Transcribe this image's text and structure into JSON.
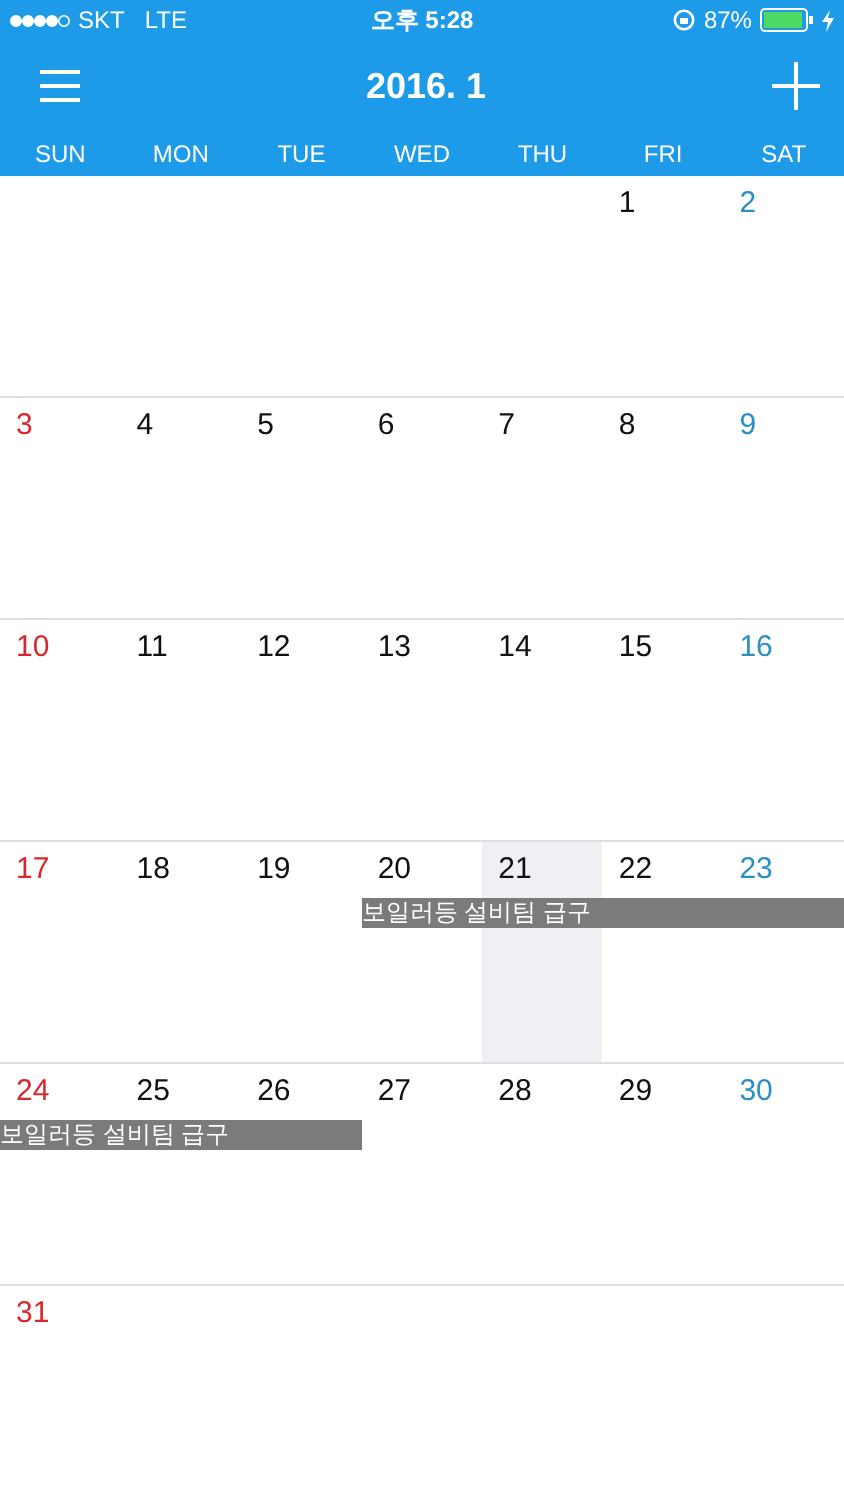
{
  "status_bar": {
    "carrier": "SKT",
    "network": "LTE",
    "time": "오후 5:28",
    "battery": "87%"
  },
  "header": {
    "title": "2016. 1"
  },
  "weekdays": [
    "SUN",
    "MON",
    "TUE",
    "WED",
    "THU",
    "FRI",
    "SAT"
  ],
  "weeks": [
    {
      "days": [
        {
          "kind": "blank"
        },
        {
          "kind": "blank"
        },
        {
          "kind": "blank"
        },
        {
          "kind": "blank"
        },
        {
          "kind": "blank"
        },
        {
          "kind": "date",
          "label": "1",
          "today": false
        },
        {
          "kind": "date",
          "label": "2",
          "today": false
        }
      ]
    },
    {
      "days": [
        {
          "kind": "date",
          "label": "3",
          "today": false
        },
        {
          "kind": "date",
          "label": "4",
          "today": false
        },
        {
          "kind": "date",
          "label": "5",
          "today": false
        },
        {
          "kind": "date",
          "label": "6",
          "today": false
        },
        {
          "kind": "date",
          "label": "7",
          "today": false
        },
        {
          "kind": "date",
          "label": "8",
          "today": false
        },
        {
          "kind": "date",
          "label": "9",
          "today": false
        }
      ]
    },
    {
      "days": [
        {
          "kind": "date",
          "label": "10",
          "today": false
        },
        {
          "kind": "date",
          "label": "11",
          "today": false
        },
        {
          "kind": "date",
          "label": "12",
          "today": false
        },
        {
          "kind": "date",
          "label": "13",
          "today": false
        },
        {
          "kind": "date",
          "label": "14",
          "today": false
        },
        {
          "kind": "date",
          "label": "15",
          "today": false
        },
        {
          "kind": "date",
          "label": "16",
          "today": false
        }
      ]
    },
    {
      "event_title": "보일러등 설비팀 급구",
      "days": [
        {
          "kind": "date",
          "label": "17",
          "today": false
        },
        {
          "kind": "date",
          "label": "18",
          "today": false
        },
        {
          "kind": "date",
          "label": "19",
          "today": false
        },
        {
          "kind": "eventday",
          "label": "20",
          "today": false
        },
        {
          "kind": "eventday",
          "label": "21",
          "today": true
        },
        {
          "kind": "eventday",
          "label": "22",
          "today": false
        },
        {
          "kind": "eventday",
          "label": "23",
          "today": false
        }
      ]
    },
    {
      "event_title": "보일러등 설비팀 급구",
      "days": [
        {
          "kind": "eventday",
          "label": "24",
          "today": false
        },
        {
          "kind": "eventday",
          "label": "25",
          "today": false
        },
        {
          "kind": "eventday",
          "label": "26",
          "today": false
        },
        {
          "kind": "date",
          "label": "27",
          "today": false
        },
        {
          "kind": "date",
          "label": "28",
          "today": false
        },
        {
          "kind": "date",
          "label": "29",
          "today": false
        },
        {
          "kind": "date",
          "label": "30",
          "today": false
        }
      ]
    },
    {
      "days": [
        {
          "kind": "date",
          "label": "31",
          "today": false
        },
        {
          "kind": "blank"
        },
        {
          "kind": "blank"
        },
        {
          "kind": "blank"
        },
        {
          "kind": "blank"
        },
        {
          "kind": "blank"
        },
        {
          "kind": "blank"
        }
      ]
    }
  ]
}
